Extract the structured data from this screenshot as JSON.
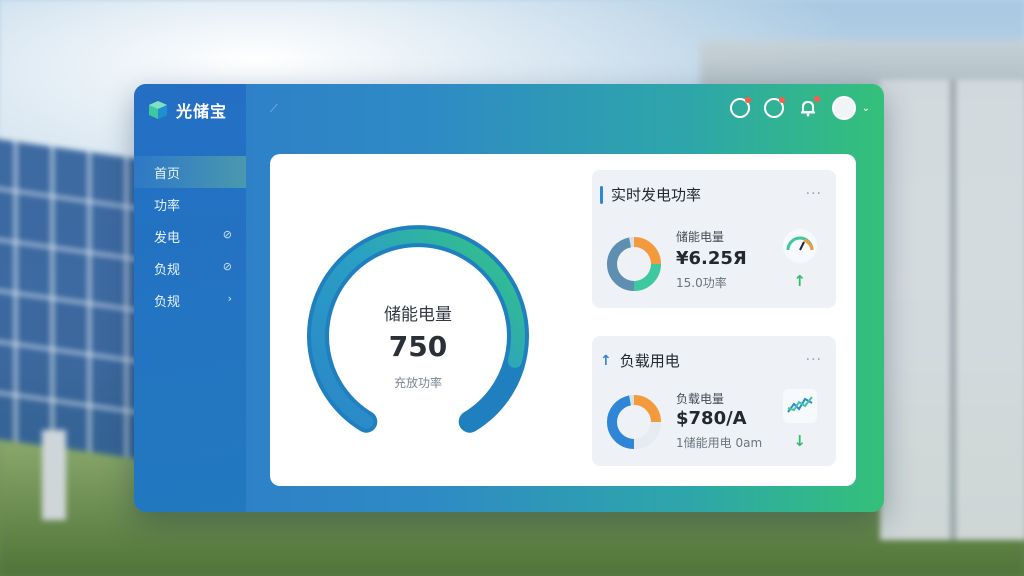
{
  "app": {
    "name": "光储宝"
  },
  "sidebar": {
    "items": [
      {
        "label": "首页",
        "icon": "",
        "active": true
      },
      {
        "label": "功率",
        "icon": ""
      },
      {
        "label": "发电",
        "icon": "⊘"
      },
      {
        "label": "负规",
        "icon": "⊘"
      },
      {
        "label": "负规",
        "icon": "›"
      }
    ]
  },
  "gauge": {
    "title": "储能电量",
    "value": "750",
    "subtitle": "充放功率",
    "level": 0.85
  },
  "cards": [
    {
      "title": "实时发电功率",
      "label": "储能电量",
      "value": "¥6.25Я",
      "sub": "15.0功率",
      "trend": "up"
    },
    {
      "title": "负载用电",
      "label": "负载电量",
      "value": "$780/A",
      "sub": "1储能用电 0am",
      "trend": "down"
    }
  ],
  "colors": {
    "accent": "#2f86d6",
    "green": "#34c07a",
    "alert": "#ff5a4a"
  }
}
